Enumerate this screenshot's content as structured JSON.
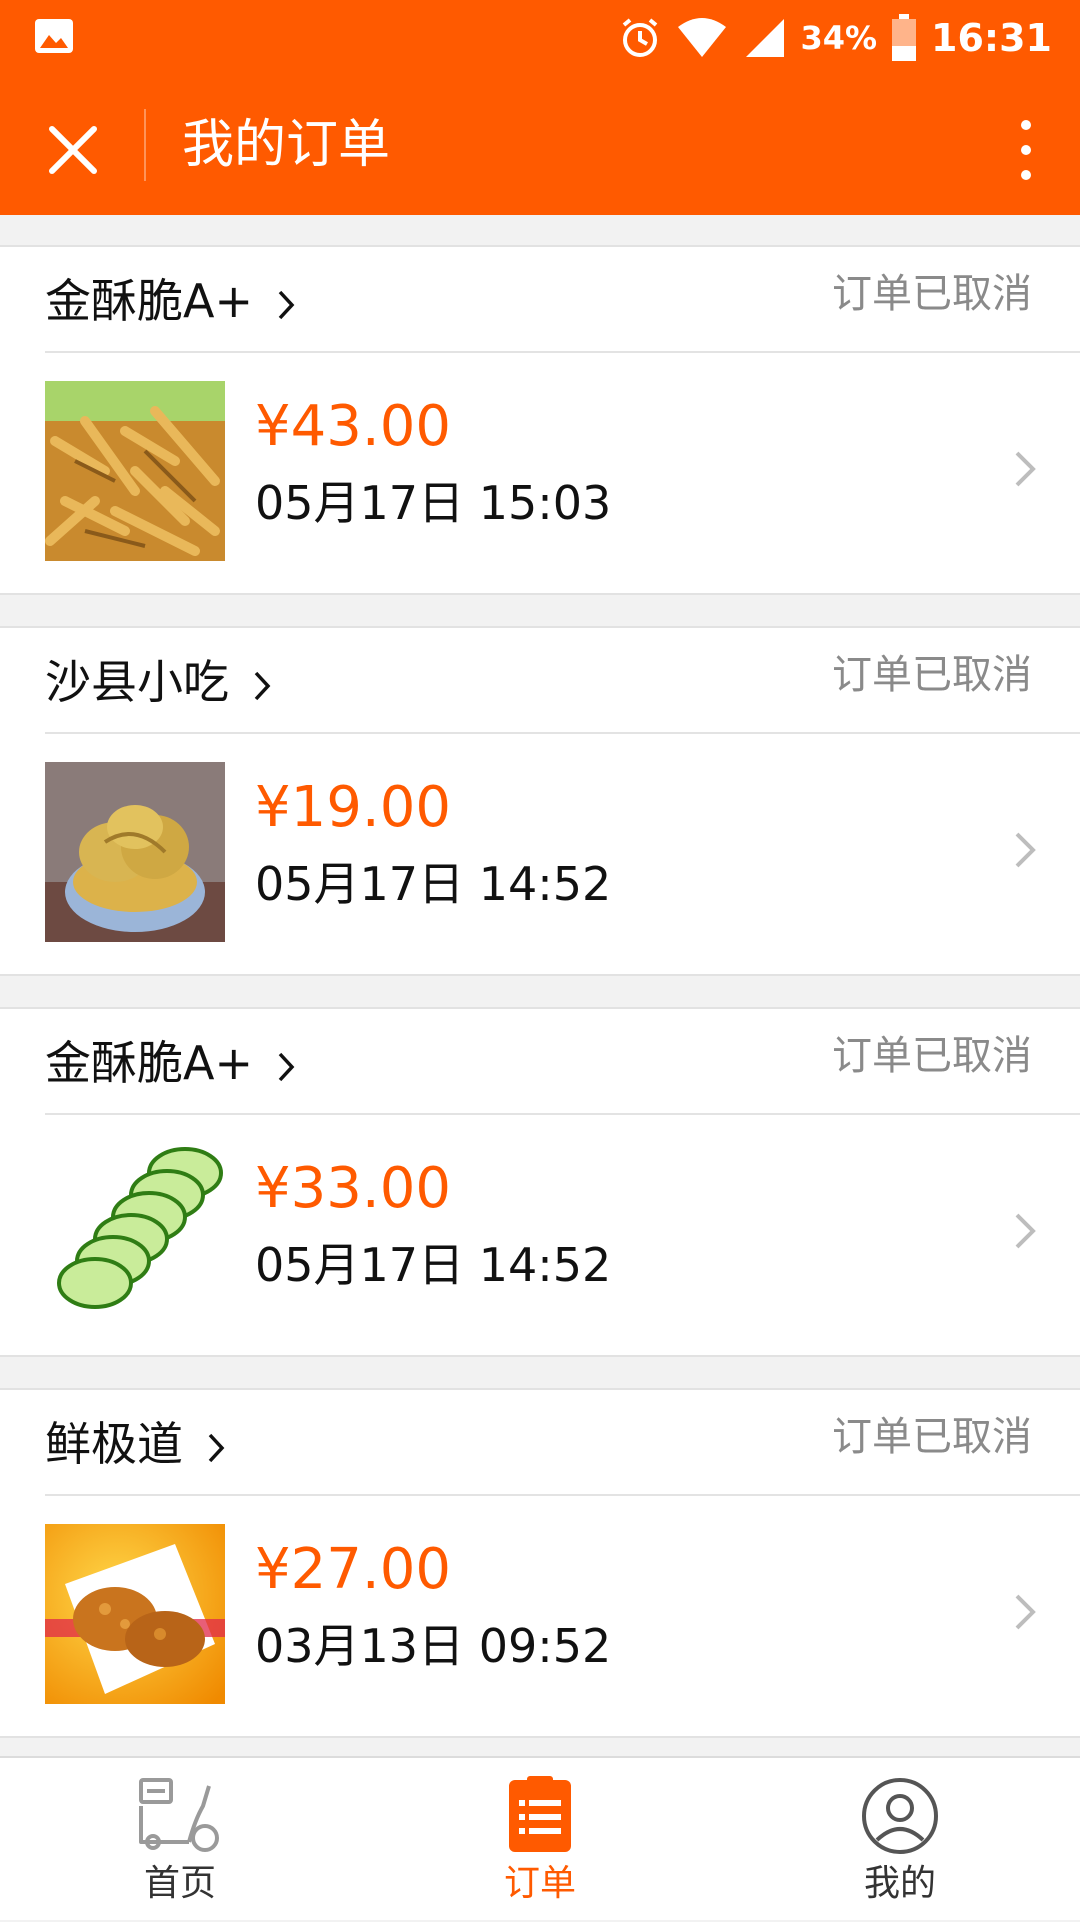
{
  "status_bar": {
    "battery": "34%",
    "time": "16:31"
  },
  "title_bar": {
    "title": "我的订单"
  },
  "orders": [
    {
      "shop": "金酥脆A+",
      "status": "订单已取消",
      "price": "¥43.00",
      "time": "05月17日 15:03",
      "image": "fried-dish"
    },
    {
      "shop": "沙县小吃",
      "status": "订单已取消",
      "price": "¥19.00",
      "time": "05月17日 14:52",
      "image": "dumplings-bowl"
    },
    {
      "shop": "金酥脆A+",
      "status": "订单已取消",
      "price": "¥33.00",
      "time": "05月17日 14:52",
      "image": "cucumber-slices"
    },
    {
      "shop": "鲜极道",
      "status": "订单已取消",
      "price": "¥27.00",
      "time": "03月13日 09:52",
      "image": "fried-chicken"
    }
  ],
  "bottom_nav": {
    "home": "首页",
    "orders": "订单",
    "profile": "我的"
  },
  "colors": {
    "accent": "#ff5a00",
    "muted": "#8a8a8a"
  }
}
